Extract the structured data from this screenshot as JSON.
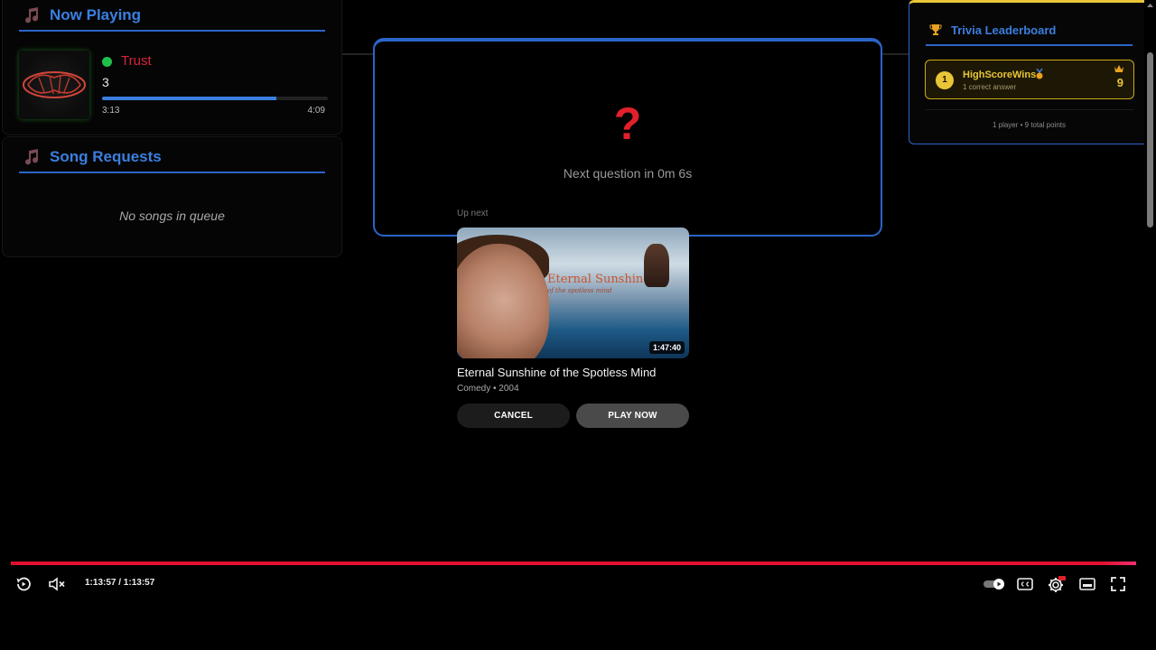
{
  "now_playing": {
    "title": "Now Playing",
    "track_title": "Trust",
    "track_artist": "3",
    "progress": 0.77,
    "elapsed": "3:13",
    "duration": "4:09"
  },
  "song_requests": {
    "title": "Song Requests",
    "empty_message": "No songs in queue"
  },
  "trivia": {
    "icon": "?",
    "countdown": "Next question in 0m 6s"
  },
  "leaderboard": {
    "title": "Trivia Leaderboard",
    "entries": [
      {
        "rank": "1",
        "name": "HighScoreWins",
        "detail": "1 correct answer",
        "score": "9"
      }
    ],
    "footer": "1 player • 9 total points"
  },
  "up_next": {
    "label": "Up next",
    "thumbnail_title": "Eternal Sunshine",
    "thumbnail_subtitle": "of the spotless mind",
    "duration": "1:47:40",
    "title": "Eternal Sunshine of the Spotless Mind",
    "meta": "Comedy • 2004",
    "cancel_label": "CANCEL",
    "play_now_label": "PLAY NOW"
  },
  "player": {
    "time": "1:13:57 / 1:13:57",
    "progress": 1.0
  },
  "colors": {
    "accent": "#2b64c8",
    "red": "#e0202a",
    "gold": "#e8c638",
    "online": "#1fbf4b"
  }
}
